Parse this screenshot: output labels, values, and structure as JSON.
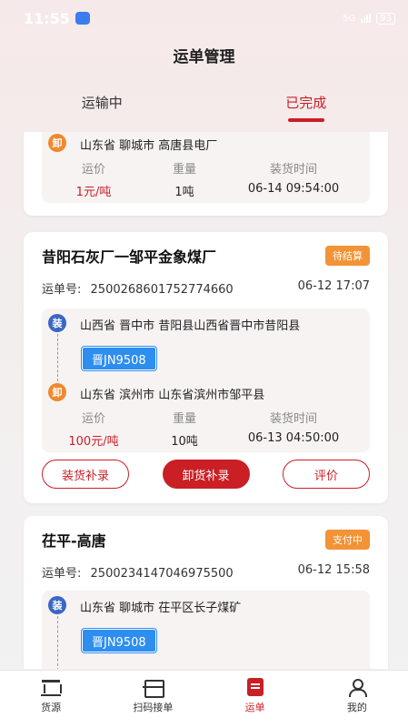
{
  "status_bar": {
    "time": "11:55",
    "battery": "93",
    "network": "5G"
  },
  "page_title": "运单管理",
  "tabs": [
    {
      "label": "运输中",
      "active": false
    },
    {
      "label": "已完成",
      "active": true
    }
  ],
  "card0": {
    "unload_badge": "卸",
    "unload_location": "山东省 聊城市 高唐县电厂",
    "stats": [
      {
        "label": "运价",
        "value": "1元/吨"
      },
      {
        "label": "重量",
        "value": "1吨"
      },
      {
        "label": "装货时间",
        "value": "06-14 09:54:00"
      }
    ]
  },
  "card1": {
    "title": "昔阳石灰厂一邹平金象煤厂",
    "status": "待结算",
    "order_label": "运单号:",
    "order_no": "2500268601752774660",
    "order_time": "06-12 17:07",
    "load_badge": "装",
    "load_location": "山西省 晋中市 昔阳县山西省晋中市昔阳县",
    "plate": "晋JN9508",
    "unload_badge": "卸",
    "unload_location": "山东省 滨州市 山东省滨州市邹平县",
    "stats": [
      {
        "label": "运价",
        "value": "100元/吨"
      },
      {
        "label": "重量",
        "value": "10吨"
      },
      {
        "label": "装货时间",
        "value": "06-13 04:50:00"
      }
    ],
    "buttons": [
      "装货补录",
      "卸货补录",
      "评价"
    ]
  },
  "card2": {
    "title": "茌平-高唐",
    "status": "支付中",
    "order_label": "运单号:",
    "order_no": "2500234147046975500",
    "order_time": "06-12 15:58",
    "load_badge": "装",
    "load_location": "山东省 聊城市 茌平区长子煤矿",
    "plate": "晋JN9508"
  },
  "bottom_nav": [
    {
      "label": "货源",
      "icon": "store-icon",
      "active": false
    },
    {
      "label": "扫码接单",
      "icon": "scan-icon",
      "active": false
    },
    {
      "label": "运单",
      "icon": "order-icon",
      "active": true
    },
    {
      "label": "我的",
      "icon": "user-icon",
      "active": false
    }
  ],
  "colors": {
    "accent": "#c91f25",
    "status_tag": "#f29337",
    "plate": "#2d8ef0",
    "unload_badge": "#f0892d",
    "load_badge": "#3a67c4"
  }
}
